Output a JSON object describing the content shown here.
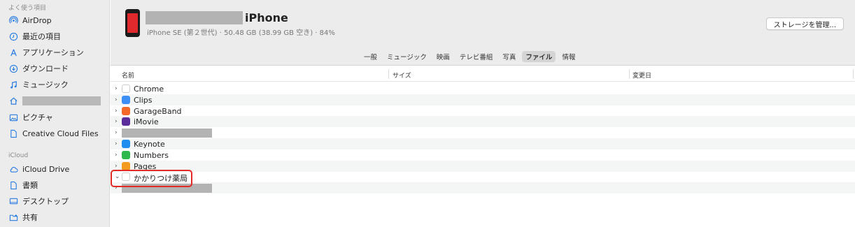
{
  "sidebar": {
    "favorites_label": "よく使う項目",
    "favorites": [
      {
        "label": "AirDrop",
        "icon": "airdrop-icon"
      },
      {
        "label": "最近の項目",
        "icon": "clock-icon"
      },
      {
        "label": "アプリケーション",
        "icon": "applications-icon"
      },
      {
        "label": "ダウンロード",
        "icon": "download-icon"
      },
      {
        "label": "ミュージック",
        "icon": "music-icon"
      },
      {
        "label": "",
        "icon": "home-icon"
      },
      {
        "label": "ピクチャ",
        "icon": "pictures-icon"
      },
      {
        "label": "Creative Cloud Files",
        "icon": "document-icon"
      }
    ],
    "icloud_label": "iCloud",
    "icloud": [
      {
        "label": "iCloud Drive",
        "icon": "cloud-icon"
      },
      {
        "label": "書類",
        "icon": "document-icon"
      },
      {
        "label": "デスクトップ",
        "icon": "desktop-icon"
      },
      {
        "label": "共有",
        "icon": "shared-folder-icon"
      }
    ]
  },
  "device": {
    "name": "iPhone",
    "info": "iPhone SE (第２世代) · 50.48 GB (38.99 GB 空き) · 84%",
    "manage_button": "ストレージを管理..."
  },
  "tabs": [
    {
      "label": "一般",
      "active": false
    },
    {
      "label": "ミュージック",
      "active": false
    },
    {
      "label": "映画",
      "active": false
    },
    {
      "label": "テレビ番組",
      "active": false
    },
    {
      "label": "写真",
      "active": false
    },
    {
      "label": "ファイル",
      "active": true
    },
    {
      "label": "情報",
      "active": false
    }
  ],
  "columns": {
    "name": "名前",
    "size": "サイズ",
    "modified": "変更日"
  },
  "files": [
    {
      "name": "Chrome",
      "icon": "chrome-icon",
      "color": "#ffffff",
      "expanded": false
    },
    {
      "name": "Clips",
      "icon": "clips-icon",
      "color": "#3d8ef5",
      "expanded": false
    },
    {
      "name": "GarageBand",
      "icon": "garageband-icon",
      "color": "#f2692a",
      "expanded": false
    },
    {
      "name": "iMovie",
      "icon": "imovie-icon",
      "color": "#5b2d9b",
      "expanded": false
    },
    {
      "name": "",
      "icon": "",
      "color": "",
      "expanded": false
    },
    {
      "name": "Keynote",
      "icon": "keynote-icon",
      "color": "#1f8ef0",
      "expanded": false
    },
    {
      "name": "Numbers",
      "icon": "numbers-icon",
      "color": "#2fb84c",
      "expanded": false
    },
    {
      "name": "Pages",
      "icon": "pages-icon",
      "color": "#f39b1e",
      "expanded": false
    },
    {
      "name": "かかりつけ薬局",
      "icon": "pharmacy-icon",
      "color": "#ffffff",
      "expanded": true
    },
    {
      "name": "",
      "icon": "",
      "color": "",
      "expanded": false
    }
  ],
  "colors": {
    "highlight": "#e32a24",
    "sidebar_bg": "#ececec",
    "phone_screen": "#e0292c"
  }
}
